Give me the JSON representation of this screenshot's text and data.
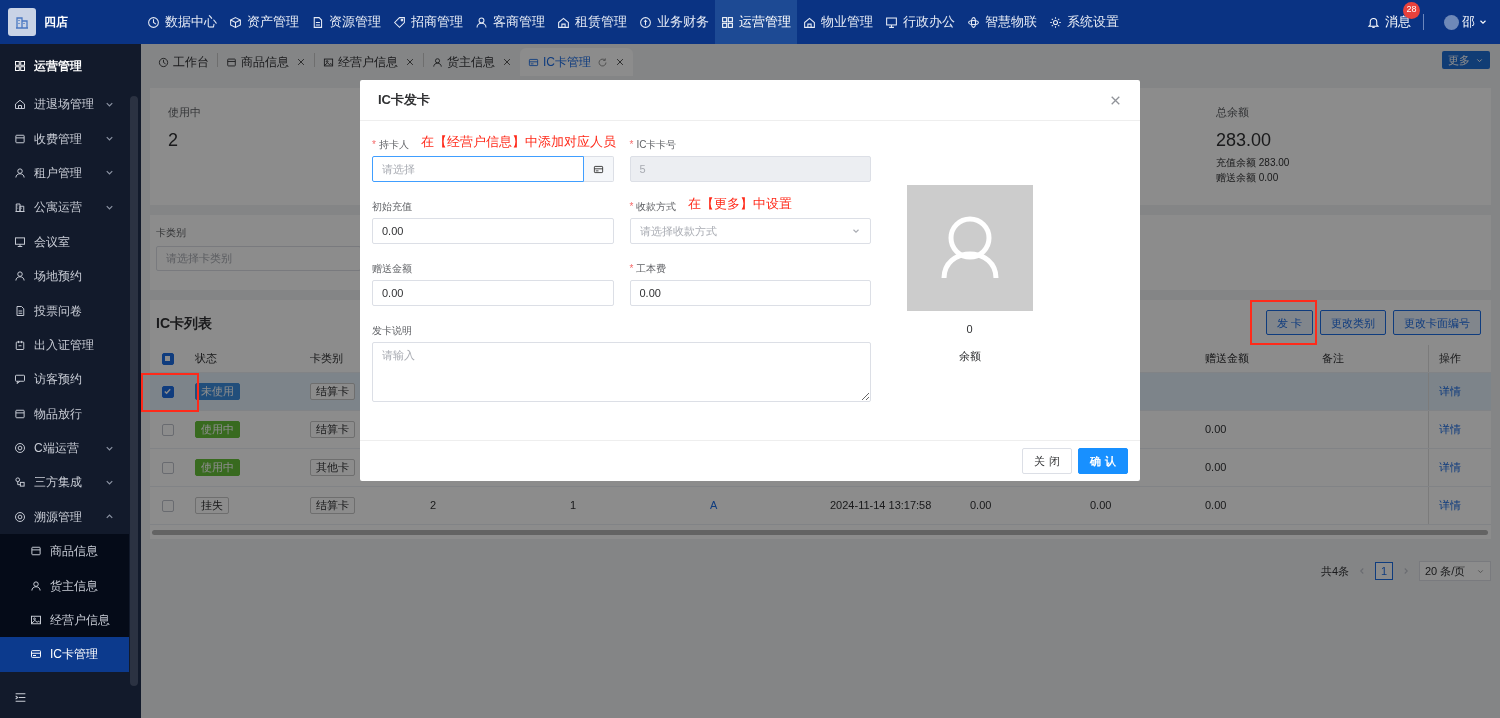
{
  "top_bar": {
    "brand": "四店",
    "nav": [
      {
        "label": "数据中心",
        "selected": false
      },
      {
        "label": "资产管理",
        "selected": false
      },
      {
        "label": "资源管理",
        "selected": false
      },
      {
        "label": "招商管理",
        "selected": false
      },
      {
        "label": "客商管理",
        "selected": false
      },
      {
        "label": "租赁管理",
        "selected": false
      },
      {
        "label": "业务财务",
        "selected": false
      },
      {
        "label": "运营管理",
        "selected": true
      },
      {
        "label": "物业管理",
        "selected": false
      },
      {
        "label": "行政办公",
        "selected": false
      },
      {
        "label": "智慧物联",
        "selected": false
      },
      {
        "label": "系统设置",
        "selected": false
      }
    ],
    "messages": {
      "label": "消息",
      "badge": "28"
    },
    "user": "邵"
  },
  "sidebar": {
    "title": "运营管理",
    "items": [
      {
        "label": "进退场管理",
        "expanded": false
      },
      {
        "label": "收费管理",
        "expanded": false
      },
      {
        "label": "租户管理",
        "expanded": false
      },
      {
        "label": "公寓运营",
        "expanded": false
      },
      {
        "label": "会议室"
      },
      {
        "label": "场地预约"
      },
      {
        "label": "投票问卷"
      },
      {
        "label": "出入证管理"
      },
      {
        "label": "访客预约"
      },
      {
        "label": "物品放行"
      },
      {
        "label": "C端运营",
        "expanded": false
      },
      {
        "label": "三方集成",
        "expanded": false
      },
      {
        "label": "溯源管理",
        "expanded": true,
        "children": [
          {
            "label": "商品信息",
            "selected": false
          },
          {
            "label": "货主信息",
            "selected": false
          },
          {
            "label": "经营户信息",
            "selected": false
          },
          {
            "label": "IC卡管理",
            "selected": true
          }
        ]
      }
    ]
  },
  "tabs": [
    {
      "label": "工作台",
      "selected": false,
      "closable": false
    },
    {
      "label": "商品信息",
      "selected": false,
      "closable": true
    },
    {
      "label": "经营户信息",
      "selected": false,
      "closable": true
    },
    {
      "label": "货主信息",
      "selected": false,
      "closable": true
    },
    {
      "label": "IC卡管理",
      "selected": true,
      "closable": true
    }
  ],
  "more_button": "更多",
  "stats": [
    {
      "label": "使用中",
      "value": "2"
    },
    {
      "label": "总余额",
      "value": "283.00",
      "details": [
        "充值余额 283.00",
        "赠送余额 0.00"
      ]
    }
  ],
  "filter": {
    "label": "卡类别",
    "placeholder": "请选择卡类别"
  },
  "table": {
    "title": "IC卡列表",
    "actions": [
      {
        "label": "发 卡",
        "highlighted": true
      },
      {
        "label": "更改类别",
        "highlighted": false
      },
      {
        "label": "更改卡面编号",
        "highlighted": false
      }
    ],
    "select_all_indeterminate": true,
    "columns": {
      "status": "状态",
      "card_type": "卡类别",
      "gift": "赠送金额",
      "note": "备注",
      "action": "操作"
    },
    "rows": [
      {
        "checked": true,
        "selected": true,
        "highlighted": true,
        "status": {
          "text": "未使用",
          "kind": "unused"
        },
        "card_type": "结算卡",
        "action": "详情"
      },
      {
        "checked": false,
        "selected": false,
        "highlighted": false,
        "status": {
          "text": "使用中",
          "kind": "in_use"
        },
        "card_type": "结算卡",
        "gift": "0.00",
        "action": "详情"
      },
      {
        "checked": false,
        "selected": false,
        "highlighted": false,
        "status": {
          "text": "使用中",
          "kind": "in_use"
        },
        "card_type": "其他卡",
        "gift": "0.00",
        "action": "详情"
      },
      {
        "checked": false,
        "selected": false,
        "highlighted": false,
        "status": {
          "text": "挂失",
          "kind": "lost"
        },
        "card_type": "结算卡",
        "column_4": "2",
        "column_5": "1",
        "column_6": "A",
        "column_7": "2024-11-14 13:17:58",
        "column_8": "0.00",
        "column_9": "0.00",
        "gift": "0.00",
        "action": "详情"
      }
    ]
  },
  "pagination": {
    "total": "共4条",
    "pages": [
      {
        "label": "1",
        "selected": true
      }
    ],
    "page_size": "20 条/页"
  },
  "dialog": {
    "title": "IC卡发卡",
    "fields": [
      {
        "kind": "picker",
        "label": "持卡人",
        "required_mark": "*",
        "placeholder": "请选择",
        "focused": true,
        "disabled": false,
        "note": "在【经营户信息】中添加对应人员"
      },
      {
        "kind": "text",
        "label": "IC卡卡号",
        "required_mark": "*",
        "value": "5",
        "focused": false,
        "disabled": true
      },
      {
        "kind": "text",
        "label": "初始充值",
        "value": "0.00",
        "focused": false,
        "disabled": false
      },
      {
        "kind": "dropdown",
        "label": "收款方式",
        "required_mark": "*",
        "placeholder": "请选择收款方式",
        "focused": false,
        "disabled": false,
        "note": "在【更多】中设置"
      },
      {
        "kind": "text",
        "label": "赠送金额",
        "value": "0.00",
        "focused": false,
        "disabled": false
      },
      {
        "kind": "text",
        "label": "工本费",
        "required_mark": "*",
        "value": "0.00",
        "focused": false,
        "disabled": false
      },
      {
        "kind": "textarea",
        "label": "发卡说明",
        "placeholder": "请输入",
        "focused": false,
        "disabled": false
      }
    ],
    "balance": {
      "value": "0",
      "label": "余额"
    },
    "buttons": [
      {
        "label": "关 闭",
        "primary": false
      },
      {
        "label": "确 认",
        "primary": true
      }
    ]
  }
}
